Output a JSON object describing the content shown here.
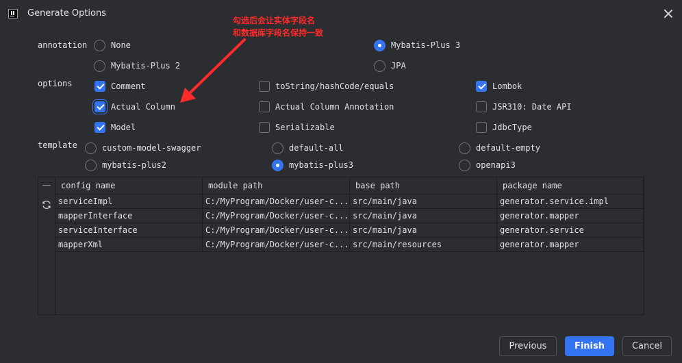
{
  "window": {
    "title": "Generate Options"
  },
  "annotation_group": {
    "label": "annotation",
    "options": [
      "None",
      "Mybatis-Plus 2",
      "Mybatis-Plus 3",
      "JPA"
    ],
    "selected": "Mybatis-Plus 3"
  },
  "options_group": {
    "label": "options",
    "items": [
      {
        "label": "Comment",
        "checked": true
      },
      {
        "label": "Actual Column",
        "checked": true
      },
      {
        "label": "Model",
        "checked": true
      },
      {
        "label": "toString/hashCode/equals",
        "checked": false
      },
      {
        "label": "Actual Column Annotation",
        "checked": false
      },
      {
        "label": "Serializable",
        "checked": false
      },
      {
        "label": "Lombok",
        "checked": true
      },
      {
        "label": "JSR310: Date API",
        "checked": false
      },
      {
        "label": "JdbcType",
        "checked": false
      }
    ]
  },
  "template_group": {
    "label": "template",
    "options": [
      "custom-model-swagger",
      "mybatis-plus2",
      "default-all",
      "mybatis-plus3",
      "default-empty",
      "openapi3"
    ],
    "selected": "mybatis-plus3"
  },
  "config_table": {
    "columns": [
      "config name",
      "module path",
      "base path",
      "package name"
    ],
    "rows": [
      [
        "serviceImpl",
        "C:/MyProgram/Docker/user-c...",
        "src/main/java",
        "generator.service.impl"
      ],
      [
        "mapperInterface",
        "C:/MyProgram/Docker/user-c...",
        "src/main/java",
        "generator.mapper"
      ],
      [
        "serviceInterface",
        "C:/MyProgram/Docker/user-c...",
        "src/main/java",
        "generator.service"
      ],
      [
        "mapperXml",
        "C:/MyProgram/Docker/user-c...",
        "src/main/resources",
        "generator.mapper"
      ]
    ]
  },
  "buttons": {
    "previous": "Previous",
    "finish": "Finish",
    "cancel": "Cancel"
  },
  "note": {
    "line1": "勾选后会让实体字段名",
    "line2": "和数据库字段名保持一致",
    "color": "#ff2a2a"
  },
  "colors": {
    "accent": "#3574f0",
    "background": "#2b2d30"
  }
}
